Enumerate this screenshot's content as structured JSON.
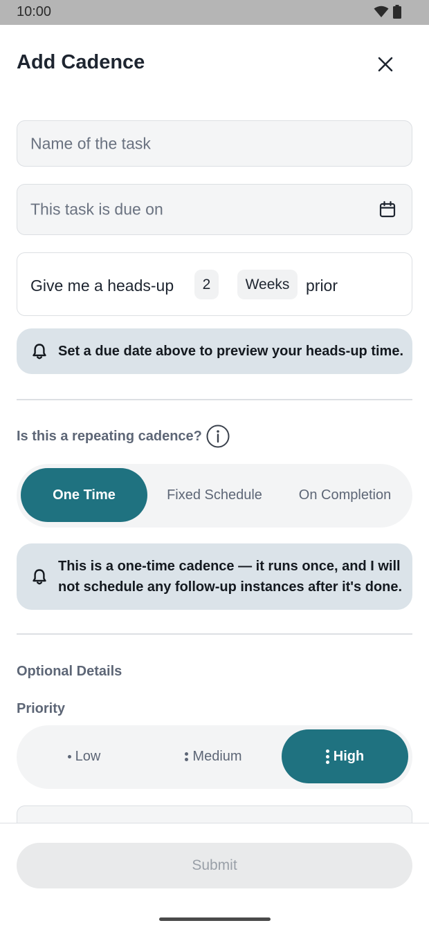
{
  "status_bar": {
    "time": "10:00",
    "icons": [
      "wifi-icon",
      "battery-icon"
    ]
  },
  "header": {
    "title": "Add Cadence",
    "close_icon": "close-icon"
  },
  "form": {
    "name_placeholder": "Name of the task",
    "due_placeholder": "This task is due on",
    "due_icon": "calendar-icon",
    "heads_up": {
      "label": "Give me a heads-up",
      "count": "2",
      "unit": "Weeks",
      "suffix": "prior"
    },
    "heads_up_notice": "Set a due date above to preview your heads-up time."
  },
  "repeat": {
    "label": "Is this a repeating cadence?",
    "info_icon": "info-icon",
    "options": [
      "One Time",
      "Fixed Schedule",
      "On Completion"
    ],
    "selected": "One Time",
    "notice": "This is a one-time cadence — it runs once, and I will not schedule any follow-up instances after it's done."
  },
  "optional": {
    "label": "Optional Details",
    "priority_label": "Priority",
    "priority_options": [
      "Low",
      "Medium",
      "High"
    ],
    "priority_selected": "High"
  },
  "footer": {
    "submit_label": "Submit"
  },
  "colors": {
    "accent": "#1f7280",
    "notice_bg": "#dbe3e9",
    "field_bg": "#f4f5f6",
    "border": "#dcdfe3",
    "disabled_text": "#9aa0a8"
  }
}
